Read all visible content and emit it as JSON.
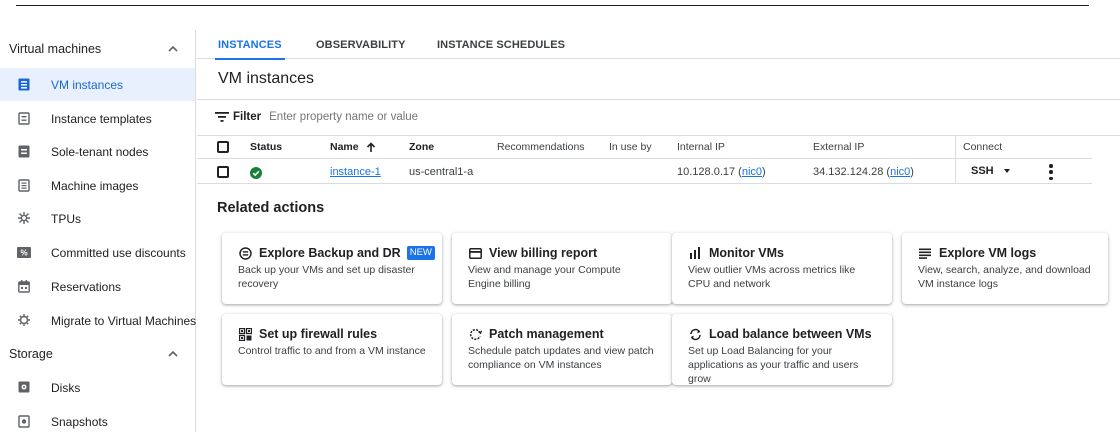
{
  "sidebar": {
    "virtual_machines": {
      "label": "Virtual machines",
      "items": [
        {
          "label": "VM instances",
          "icon": "vm-instances-icon",
          "active": true
        },
        {
          "label": "Instance templates",
          "icon": "instance-templates-icon"
        },
        {
          "label": "Sole-tenant nodes",
          "icon": "sole-tenant-nodes-icon"
        },
        {
          "label": "Machine images",
          "icon": "machine-images-icon"
        },
        {
          "label": "TPUs",
          "icon": "tpu-icon"
        },
        {
          "label": "Committed use discounts",
          "icon": "percent-icon"
        },
        {
          "label": "Reservations",
          "icon": "calendar-icon"
        },
        {
          "label": "Migrate to Virtual Machines",
          "icon": "migrate-icon"
        }
      ]
    },
    "storage": {
      "label": "Storage",
      "items": [
        {
          "label": "Disks",
          "icon": "disk-icon"
        },
        {
          "label": "Snapshots",
          "icon": "snapshot-icon"
        }
      ]
    }
  },
  "tabs": [
    {
      "label": "INSTANCES",
      "active": true
    },
    {
      "label": "OBSERVABILITY"
    },
    {
      "label": "INSTANCE SCHEDULES"
    }
  ],
  "page_title": "VM instances",
  "filter": {
    "label": "Filter",
    "placeholder": "Enter property name or value"
  },
  "table": {
    "columns": {
      "status": "Status",
      "name": "Name",
      "zone": "Zone",
      "recommendations": "Recommendations",
      "in_use_by": "In use by",
      "internal_ip": "Internal IP",
      "external_ip": "External IP",
      "connect": "Connect"
    },
    "rows": [
      {
        "status": "running",
        "name": "instance-1",
        "zone": "us-central1-a",
        "internal_ip": "10.128.0.17",
        "internal_nic": "nic0",
        "external_ip": "34.132.124.28",
        "external_nic": "nic0",
        "connect": "SSH"
      }
    ]
  },
  "related": {
    "title": "Related actions",
    "cards": [
      {
        "title": "Explore Backup and DR",
        "badge": "NEW",
        "desc": "Back up your VMs and set up disaster recovery",
        "icon": "backup-icon"
      },
      {
        "title": "View billing report",
        "desc": "View and manage your Compute Engine billing",
        "icon": "billing-icon"
      },
      {
        "title": "Monitor VMs",
        "desc": "View outlier VMs across metrics like CPU and network",
        "icon": "monitor-icon"
      },
      {
        "title": "Explore VM logs",
        "desc": "View, search, analyze, and download VM instance logs",
        "icon": "logs-icon"
      },
      {
        "title": "Set up firewall rules",
        "desc": "Control traffic to and from a VM instance",
        "icon": "firewall-icon"
      },
      {
        "title": "Patch management",
        "desc": "Schedule patch updates and view patch compliance on VM instances",
        "icon": "patch-icon"
      },
      {
        "title": "Load balance between VMs",
        "desc": "Set up Load Balancing for your applications as your traffic and users grow",
        "icon": "load-balance-icon"
      }
    ]
  },
  "colors": {
    "accent": "#1a73e8",
    "active_bg": "#e8f0fe",
    "status_ok": "#188038"
  }
}
